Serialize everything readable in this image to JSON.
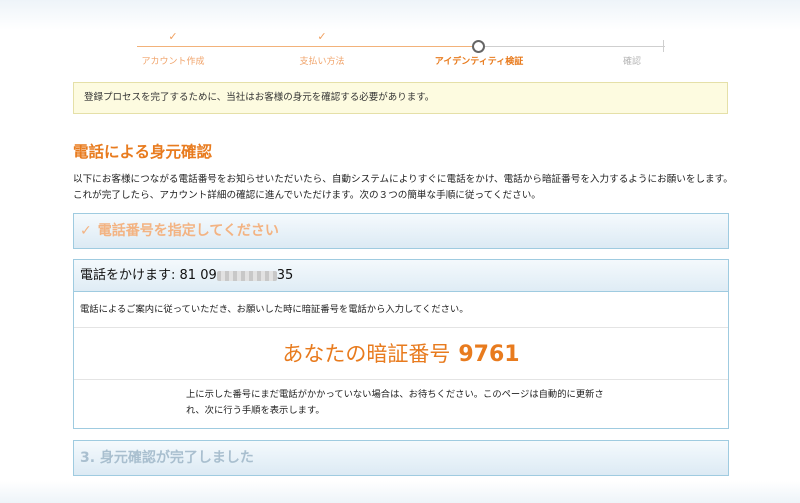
{
  "progress": {
    "steps": [
      {
        "label": "アカウント作成",
        "state": "done",
        "check": "✓"
      },
      {
        "label": "支払い方法",
        "state": "done",
        "check": "✓"
      },
      {
        "label": "アイデンティティ検証",
        "state": "current"
      },
      {
        "label": "確認",
        "state": "pending"
      }
    ]
  },
  "notice": "登録プロセスを完了するために、当社はお客様の身元を確認する必要があります。",
  "section_title": "電話による身元確認",
  "intro_text": "以下にお客様につながる電話番号をお知らせいただいたら、自動システムによりすぐに電話をかけ、電話から暗証番号を入力するようにお願いをします。これが完了したら、アカウント詳細の確認に進んでいただけます。次の３つの簡単な手順に従ってください。",
  "step1": {
    "check": "✓",
    "title": "電話番号を指定してください"
  },
  "call": {
    "heading_prefix": "電話をかけます:",
    "phone_start": "81 09",
    "phone_end": "35",
    "instruction": "電話によるご案内に従っていただき、お願いした時に暗証番号を電話から入力してください。",
    "pin_label": "あなたの暗証番号",
    "pin_code": "9761",
    "wait_text": "上に示した番号にまだ電話がかかっていない場合は、お待ちください。このページは自動的に更新され、次に行う手順を表示します。"
  },
  "step3": {
    "title": "3. 身元確認が完了しました"
  },
  "colors": {
    "accent": "#e87b1e",
    "panel_border": "#9fcbe0",
    "notice_bg": "#fdfbe0"
  }
}
